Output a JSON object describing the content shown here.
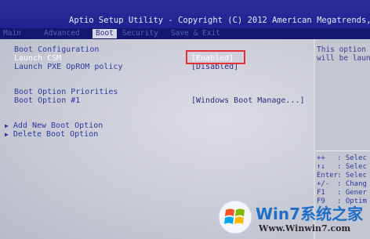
{
  "title": "Aptio Setup Utility - Copyright (C) 2012 American Megatrends,",
  "tabs": [
    "Main",
    "Advanced",
    "Boot",
    "Security",
    "Save & Exit"
  ],
  "active_tab": "Boot",
  "sections": {
    "boot_config": "Boot Configuration",
    "priorities": "Boot Option Priorities"
  },
  "items": {
    "launch_csm": {
      "label": "Launch CSM",
      "value": "[Enabled]"
    },
    "launch_pxe": {
      "label": "Launch PXE OpROM policy",
      "value": "[Disabled]"
    },
    "boot_option_1": {
      "label": "Boot Option #1",
      "value": "[Windows Boot Manage...]"
    },
    "add_boot": {
      "label": "Add New Boot Option"
    },
    "delete_boot": {
      "label": "Delete Boot Option"
    }
  },
  "help": {
    "line1": "This option",
    "line2": "will be laun"
  },
  "keys": [
    {
      "key": "++",
      "desc": ": Selec"
    },
    {
      "key": "↑↓",
      "desc": ": Selec"
    },
    {
      "key": "Enter",
      "desc": ": Selec"
    },
    {
      "key": "+/-",
      "desc": ": Chang"
    },
    {
      "key": "F1",
      "desc": ": Gener"
    },
    {
      "key": "F9",
      "desc": ": Optim"
    }
  ],
  "watermark": {
    "title": "Win7系统之家",
    "url": "Www.Winwin7.com"
  },
  "colors": {
    "highlight": "#e53036",
    "bios_blue": "#14186e",
    "panel_grey": "#d0d1dc"
  }
}
